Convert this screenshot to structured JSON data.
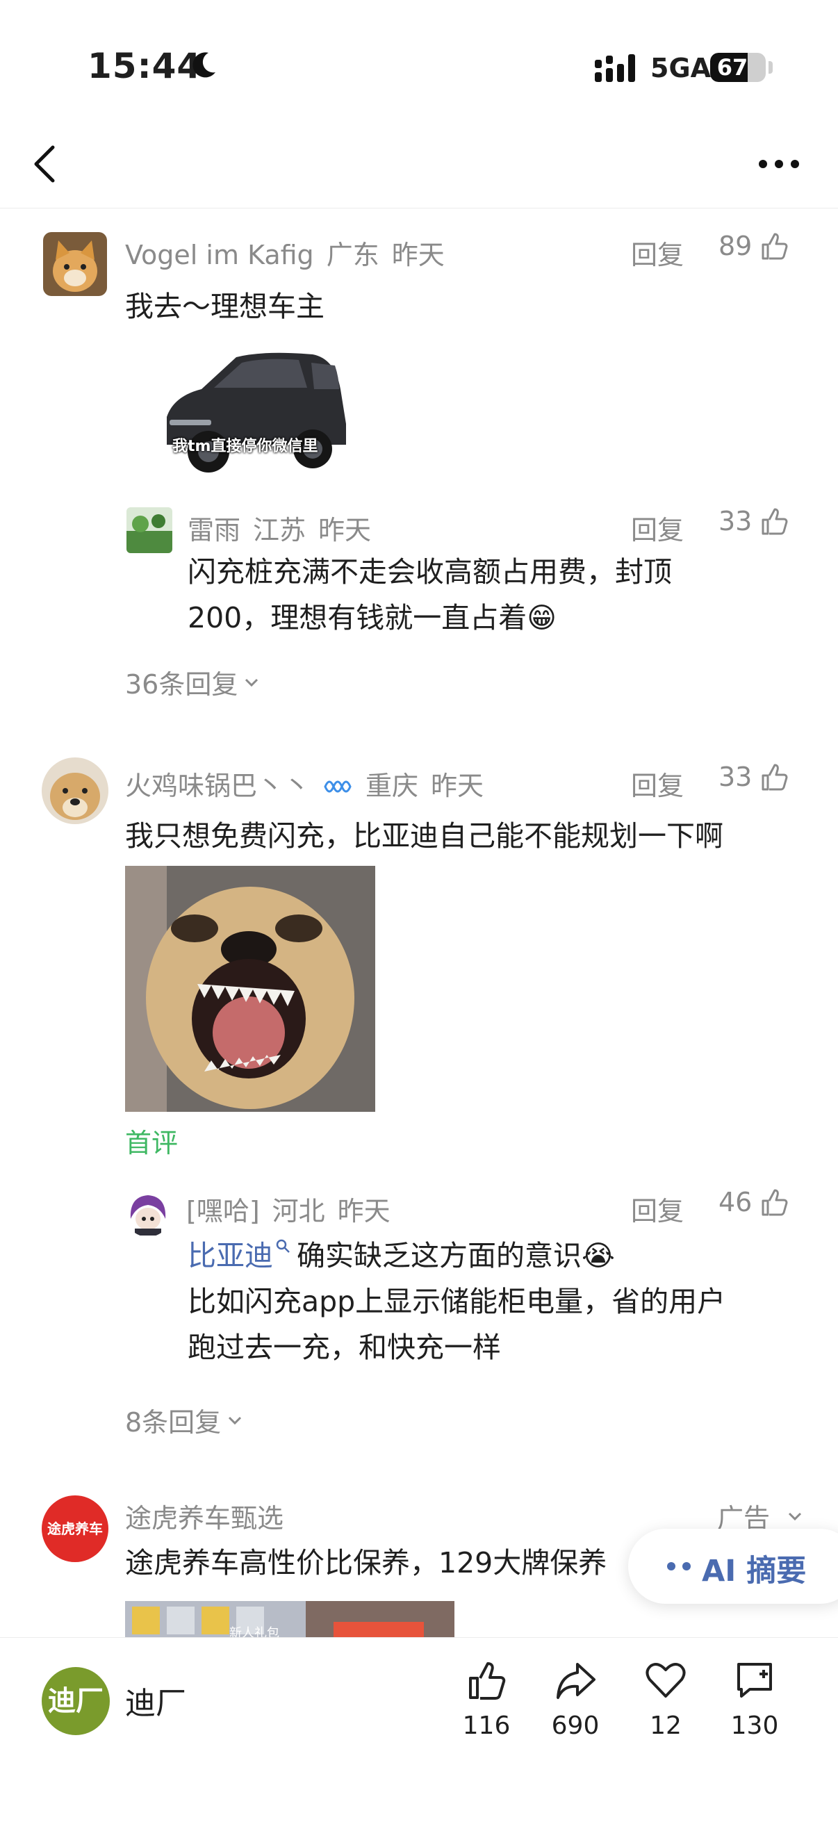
{
  "status_bar": {
    "time": "15:44",
    "network": "5GA",
    "battery": "67",
    "battery_level": 0.67
  },
  "comments": [
    {
      "user": "Vogel im Kafig",
      "region": "广东",
      "time": "昨天",
      "reply_label": "回复",
      "likes": "89",
      "text": "我去～理想车主",
      "image_caption": "我tm直接停你微信里",
      "sub_reply": {
        "user": "雷雨",
        "region": "江苏",
        "time": "昨天",
        "reply_label": "回复",
        "likes": "33",
        "text_line1": "闪充桩充满不走会收高额占用费，封顶",
        "text_line2": "200，理想有钱就一直占着😁"
      },
      "more_replies": "36条回复"
    },
    {
      "user": "火鸡味锅巴丶丶",
      "region": "重庆",
      "time": "昨天",
      "reply_label": "回复",
      "likes": "33",
      "text": "我只想免费闪充，比亚迪自己能不能规划一下啊",
      "tag": "首评",
      "sub_reply": {
        "user": "[嘿哈]",
        "region": "河北",
        "time": "昨天",
        "reply_label": "回复",
        "likes": "46",
        "mention": "比亚迪",
        "text_line1_rest": "确实缺乏这方面的意识😭",
        "text_line2": "比如闪充app上显示储能柜电量，省的用户",
        "text_line3": "跑过去一充，和快充一样"
      },
      "more_replies": "8条回复"
    }
  ],
  "ad": {
    "user": "途虎养车甄选",
    "avatar_text": "途虎养车",
    "ad_label": "广告",
    "text": "途虎养车高性价比保养，129大牌保养",
    "image_badge": "新人礼包"
  },
  "ai_summary": {
    "label": "AI 摘要"
  },
  "bottom_bar": {
    "channel_avatar": "迪厂",
    "channel_name": "迪厂",
    "like_count": "116",
    "share_count": "690",
    "favorite_count": "12",
    "comment_count": "130"
  },
  "colors": {
    "meta_gray": "#8a8a8a",
    "mention_blue": "#4a6bb0",
    "tag_green": "#3fb863"
  }
}
